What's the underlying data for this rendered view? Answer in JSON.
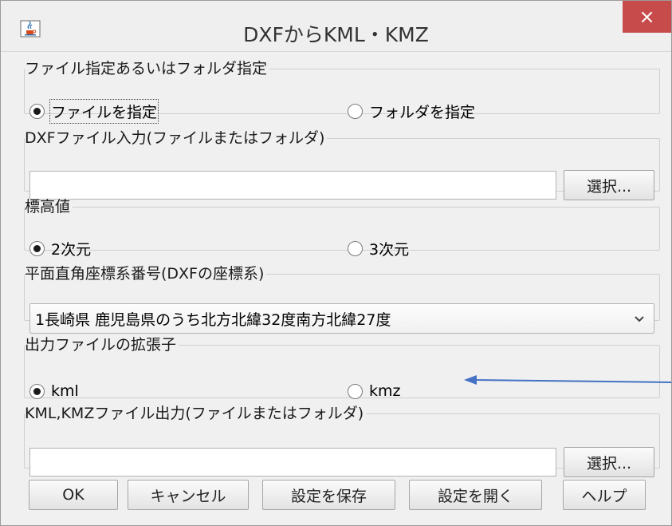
{
  "window": {
    "title": "DXFからKML・KMZ",
    "close_glyph": "×",
    "app_icon": "java-cup-icon"
  },
  "file_spec": {
    "legend": "ファイル指定あるいはフォルダ指定",
    "options": [
      {
        "label": "ファイルを指定",
        "selected": true
      },
      {
        "label": "フォルダを指定",
        "selected": false
      }
    ]
  },
  "dxf_input": {
    "legend": "DXFファイル入力(ファイルまたはフォルダ)",
    "value": "",
    "select_label": "選択..."
  },
  "elevation": {
    "legend": "標高値",
    "options": [
      {
        "label": "2次元",
        "selected": true
      },
      {
        "label": "3次元",
        "selected": false
      }
    ]
  },
  "coord_system": {
    "legend": "平面直角座標系番号(DXFの座標系)",
    "selected": "1長崎県 鹿児島県のうち北方北緯32度南方北緯27度",
    "dropdown_icon": "chevron-down-icon"
  },
  "output_ext": {
    "legend": "出力ファイルの拡張子",
    "options": [
      {
        "label": "kml",
        "selected": true
      },
      {
        "label": "kmz",
        "selected": false
      }
    ]
  },
  "kml_output": {
    "legend": "KML,KMZファイル出力(ファイルまたはフォルダ)",
    "value": "",
    "select_label": "選択..."
  },
  "buttons": {
    "ok": "OK",
    "cancel": "キャンセル",
    "save_settings": "設定を保存",
    "open_settings": "設定を開く",
    "help": "ヘルプ"
  },
  "colors": {
    "close_button": "#c84b4b",
    "annotation_arrow": "#4472c4"
  }
}
